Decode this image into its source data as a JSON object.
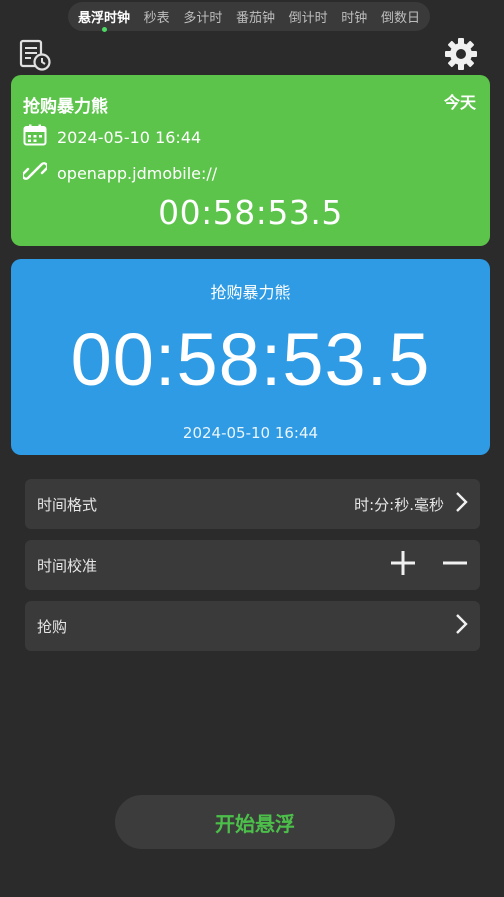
{
  "tabs": [
    "悬浮时钟",
    "秒表",
    "多计时",
    "番茄钟",
    "倒计时",
    "时钟",
    "倒数日"
  ],
  "active_tab": 0,
  "green_card": {
    "title": "抢购暴力熊",
    "badge": "今天",
    "datetime": "2024-05-10 16:44",
    "link": "openapp.jdmobile://",
    "countdown": "00:58:53.5"
  },
  "blue_card": {
    "title": "抢购暴力熊",
    "countdown": "00:58:53.5",
    "datetime": "2024-05-10 16:44"
  },
  "settings": {
    "time_format_label": "时间格式",
    "time_format_value": "时:分:秒.毫秒",
    "calibration_label": "时间校准",
    "purchase_label": "抢购"
  },
  "start_button": "开始悬浮",
  "colors": {
    "green": "#5dc44b",
    "blue": "#2e9be4",
    "accent": "#4cbf4a"
  }
}
